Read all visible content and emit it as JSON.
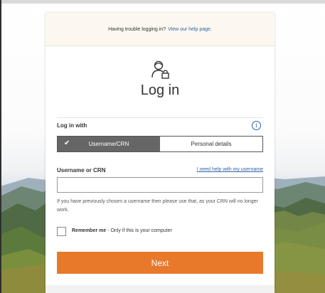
{
  "notice": {
    "text": "Having trouble logging in?",
    "link": "View our help page."
  },
  "icons": {
    "login": "user-lock-icon",
    "info": "info-icon",
    "check": "check-icon"
  },
  "title": "Log in",
  "login_with": {
    "label": "Log in with",
    "options": [
      "Username/CRN",
      "Personal details"
    ],
    "selected": "Username/CRN"
  },
  "username": {
    "label": "Username or CRN",
    "help_link": "I need help with my username",
    "value": "",
    "placeholder": "",
    "hint": "If you have previously chosen a username then please use that, as your CRN will no longer work."
  },
  "remember": {
    "bold": "Remember me",
    "rest": " - Only if this is your computer",
    "checked": false
  },
  "next_label": "Next",
  "colors": {
    "accent": "#e8792b",
    "link": "#2b63a8",
    "notice_bg": "#fcf8ef",
    "toggle_active": "#666666"
  }
}
